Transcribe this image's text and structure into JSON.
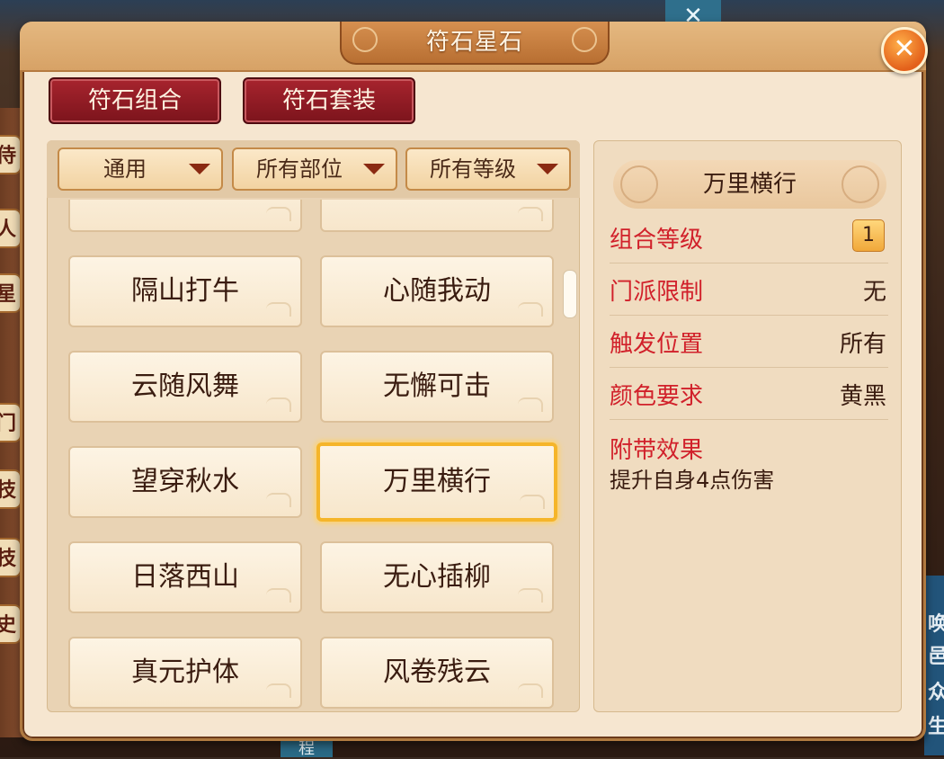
{
  "window": {
    "title": "符石星石",
    "close_glyph": "✕"
  },
  "tabs": [
    {
      "label": "符石组合"
    },
    {
      "label": "符石套装"
    }
  ],
  "filters": [
    {
      "value": "通用"
    },
    {
      "value": "所有部位"
    },
    {
      "value": "所有等级"
    }
  ],
  "runes": [
    {
      "name": "隔山打牛"
    },
    {
      "name": "心随我动"
    },
    {
      "name": "云随风舞"
    },
    {
      "name": "无懈可击"
    },
    {
      "name": "望穿秋水"
    },
    {
      "name": "万里横行",
      "selected": true
    },
    {
      "name": "日落西山"
    },
    {
      "name": "无心插柳"
    },
    {
      "name": "真元护体"
    },
    {
      "name": "风卷残云"
    }
  ],
  "detail": {
    "title": "万里横行",
    "rows": [
      {
        "key": "组合等级",
        "value": "1"
      },
      {
        "key": "门派限制",
        "value": "无"
      },
      {
        "key": "触发位置",
        "value": "所有"
      },
      {
        "key": "颜色要求",
        "value": "黄黑"
      }
    ],
    "effect_label": "附带效果",
    "effect_text": "提升自身4点伤害"
  },
  "background": {
    "left_tabs": [
      "侍",
      "人",
      "星",
      "门",
      "技",
      "技",
      "史"
    ],
    "right_chars": [
      "唤",
      "邑",
      "众",
      "生"
    ],
    "bottom_tag": "程",
    "top_x": "✕"
  },
  "colors": {
    "accent_red": "#d1202a",
    "tab_red": "#8c1a22",
    "selected_gold": "#f5b52a"
  }
}
